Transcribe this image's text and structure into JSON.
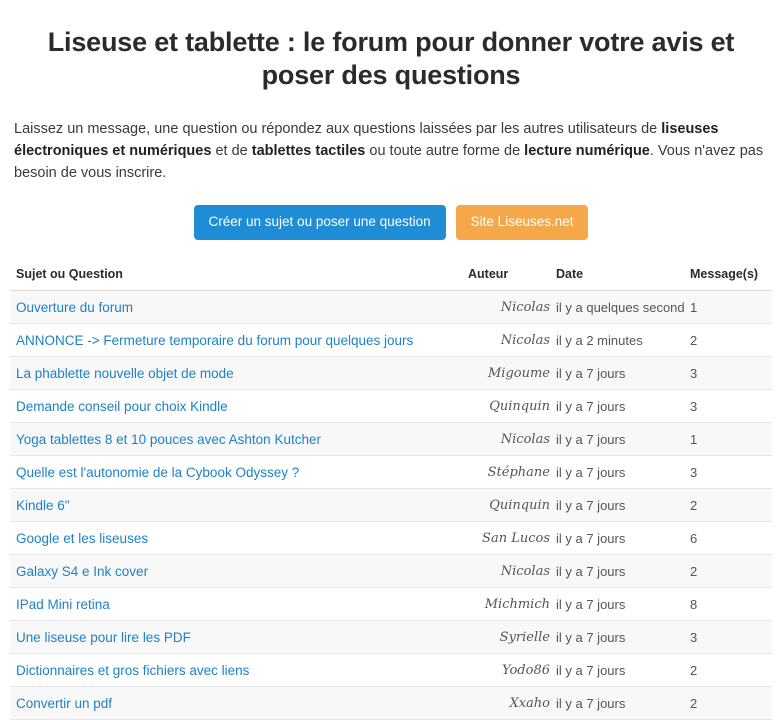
{
  "header": {
    "title": "Liseuse et tablette : le forum pour donner votre avis et poser des questions"
  },
  "intro": {
    "part1": "Laissez un message, une question ou répondez aux questions laissées par les autres utilisateurs de ",
    "bold1": "liseuses électroniques et numériques",
    "part2": " et de ",
    "bold2": "tablettes tactiles",
    "part3": " ou toute autre forme de ",
    "bold3": "lecture numérique",
    "part4": ". Vous n'avez pas besoin de vous inscrire."
  },
  "buttons": {
    "create_topic": "Créer un sujet ou poser une question",
    "site_link": "Site Liseuses.net",
    "primary_color": "#1f8dd6",
    "accent_color": "#f4a84a"
  },
  "table": {
    "columns": [
      "Sujet ou Question",
      "Auteur",
      "Date",
      "Message(s)"
    ],
    "rows": [
      {
        "subject": "Ouverture du forum",
        "author": "Nicolas",
        "date": "il y a quelques secondes",
        "messages": "1"
      },
      {
        "subject": "ANNONCE -> Fermeture temporaire du forum pour quelques jours",
        "author": "Nicolas",
        "date": "il y a 2 minutes",
        "messages": "2"
      },
      {
        "subject": "La phablette nouvelle objet de mode",
        "author": "Migoume",
        "date": "il y a 7 jours",
        "messages": "3"
      },
      {
        "subject": "Demande conseil pour choix Kindle",
        "author": "Quinquin",
        "date": "il y a 7 jours",
        "messages": "3"
      },
      {
        "subject": "Yoga tablettes 8 et 10 pouces avec Ashton Kutcher",
        "author": "Nicolas",
        "date": "il y a 7 jours",
        "messages": "1"
      },
      {
        "subject": "Quelle est l'autonomie de la Cybook Odyssey ?",
        "author": "Stéphane",
        "date": "il y a 7 jours",
        "messages": "3"
      },
      {
        "subject": "Kindle 6\"",
        "author": "Quinquin",
        "date": "il y a 7 jours",
        "messages": "2"
      },
      {
        "subject": "Google et les liseuses",
        "author": "San Lucos",
        "date": "il y a 7 jours",
        "messages": "6"
      },
      {
        "subject": "Galaxy S4 e Ink cover",
        "author": "Nicolas",
        "date": "il y a 7 jours",
        "messages": "2"
      },
      {
        "subject": "IPad Mini retina",
        "author": "Michmich",
        "date": "il y a 7 jours",
        "messages": "8"
      },
      {
        "subject": "Une liseuse pour lire les PDF",
        "author": "Syrielle",
        "date": "il y a 7 jours",
        "messages": "3"
      },
      {
        "subject": "Dictionnaires et gros fichiers avec liens",
        "author": "Yodo86",
        "date": "il y a 7 jours",
        "messages": "2"
      },
      {
        "subject": "Convertir un pdf",
        "author": "Xxaho",
        "date": "il y a 7 jours",
        "messages": "2"
      }
    ]
  }
}
